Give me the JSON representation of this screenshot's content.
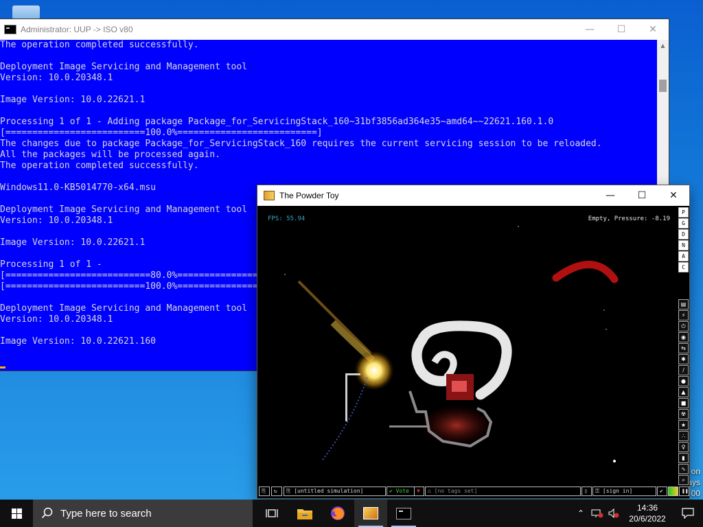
{
  "cmd": {
    "title": "Administrator: UUP -> ISO v80",
    "lines": [
      "The operation completed successfully.",
      "",
      "Deployment Image Servicing and Management tool",
      "Version: 10.0.20348.1",
      "",
      "Image Version: 10.0.22621.1",
      "",
      "Processing 1 of 1 - Adding package Package_for_ServicingStack_160~31bf3856ad364e35~amd64~~22621.160.1.0",
      "[==========================100.0%==========================]",
      "The changes due to package Package_for_ServicingStack_160 requires the current servicing session to be reloaded.",
      "All the packages will be processed again.",
      "The operation completed successfully.",
      "",
      "Windows11.0-KB5014770-x64.msu",
      "",
      "Deployment Image Servicing and Management tool",
      "Version: 10.0.20348.1",
      "",
      "Image Version: 10.0.22621.1",
      "",
      "Processing 1 of 1 -",
      "[===========================80.0%=========================",
      "[==========================100.0%=========================",
      "",
      "Deployment Image Servicing and Management tool",
      "Version: 10.0.20348.1",
      "",
      "Image Version: 10.0.22621.160"
    ],
    "controls": {
      "minimize": "—",
      "maximize": "☐",
      "close": "✕"
    }
  },
  "powder_toy": {
    "title": "The Powder Toy",
    "fps": "FPS: 55.94",
    "pressure": "Empty, Pressure: -8.19",
    "controls": {
      "minimize": "—",
      "maximize": "☐",
      "close": "✕"
    },
    "sidebar_letters": [
      "P",
      "G",
      "D",
      "N",
      "A",
      "C"
    ],
    "status": {
      "simulation_name": "[untitled simulation]",
      "vote_label": "Vote",
      "tags_placeholder": "[no tags set]",
      "sign_in": "[sign in]"
    }
  },
  "taskbar": {
    "search_placeholder": "Type here to search",
    "time": "14:36",
    "date": "20/6/2022"
  },
  "desktop_edge_text": [
    "on",
    "ays",
    "00"
  ]
}
